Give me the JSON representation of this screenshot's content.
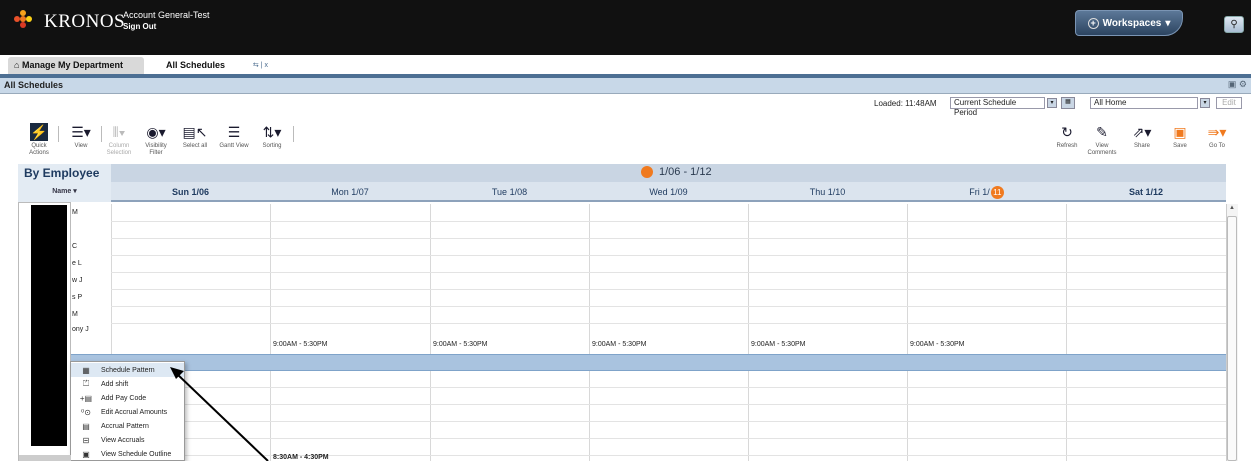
{
  "header": {
    "brand": "KRONOS",
    "account_name": "Account General-Test",
    "sign_out": "Sign Out",
    "workspaces_label": "Workspaces",
    "search_icon": "magnifier-icon"
  },
  "tabs": [
    {
      "label": "Manage My Department",
      "icon": "home-icon"
    },
    {
      "label": "All Schedules",
      "controls": "⇆ | x"
    }
  ],
  "panel": {
    "title": "All Schedules"
  },
  "load_bar": {
    "loaded_text": "Loaded: 11:48AM",
    "period_value": "Current Schedule Period",
    "location_value": "All Home",
    "edit_label": "Edit"
  },
  "toolbar": {
    "left": [
      {
        "label": "Quick Actions",
        "icon": "lightning-icon"
      },
      {
        "label": "View",
        "icon": "people-list-icon"
      },
      {
        "label": "Column Selection",
        "icon": "columns-icon"
      },
      {
        "label": "Visibility Filter",
        "icon": "eye-icon"
      },
      {
        "label": "Select all",
        "icon": "select-all-icon"
      },
      {
        "label": "Gantt View",
        "icon": "gantt-icon"
      },
      {
        "label": "Sorting",
        "icon": "sort-icon"
      }
    ],
    "right": [
      {
        "label": "Refresh",
        "icon": "refresh-icon"
      },
      {
        "label": "View Comments",
        "icon": "comments-icon"
      },
      {
        "label": "Share",
        "icon": "share-icon"
      },
      {
        "label": "Save",
        "icon": "save-icon"
      },
      {
        "label": "Go To",
        "icon": "goto-icon"
      }
    ]
  },
  "grid": {
    "group_label": "By Employee",
    "name_header": "Name",
    "week_label": "1/06 - 1/12",
    "days": [
      {
        "label": "Sun 1/06",
        "bold": true
      },
      {
        "label": "Mon 1/07",
        "bold": false
      },
      {
        "label": "Tue 1/08",
        "bold": false
      },
      {
        "label": "Wed 1/09",
        "bold": false
      },
      {
        "label": "Thu 1/10",
        "bold": false
      },
      {
        "label": "Fri 1/",
        "badge": "11",
        "bold": false
      },
      {
        "label": "Sat 1/12",
        "bold": true
      }
    ],
    "employee_fragments": [
      "M",
      "",
      "C",
      "e L",
      "w J",
      "s P",
      "M",
      "ony J"
    ],
    "shifts_row8": [
      "9:00AM - 5:30PM",
      "9:00AM - 5:30PM",
      "9:00AM - 5:30PM",
      "9:00AM - 5:30PM",
      "9:00AM - 5:30PM"
    ],
    "shift_bottom": "8:30AM - 4:30PM"
  },
  "context_menu": [
    {
      "label": "Schedule Pattern",
      "icon": "grid-icon"
    },
    {
      "label": "Add shift",
      "icon": "add-shift-icon"
    },
    {
      "label": "Add Pay Code",
      "icon": "pay-code-icon"
    },
    {
      "label": "Edit Accrual Amounts",
      "icon": "accrual-edit-icon"
    },
    {
      "label": "Accrual Pattern",
      "icon": "accrual-pattern-icon"
    },
    {
      "label": "View Accruals",
      "icon": "view-accruals-icon"
    },
    {
      "label": "View Schedule Outline",
      "icon": "outline-icon"
    }
  ],
  "colors": {
    "accent_orange": "#f07a1f",
    "header_blue": "#c9d5e3",
    "selected_row": "#a9c3df"
  }
}
